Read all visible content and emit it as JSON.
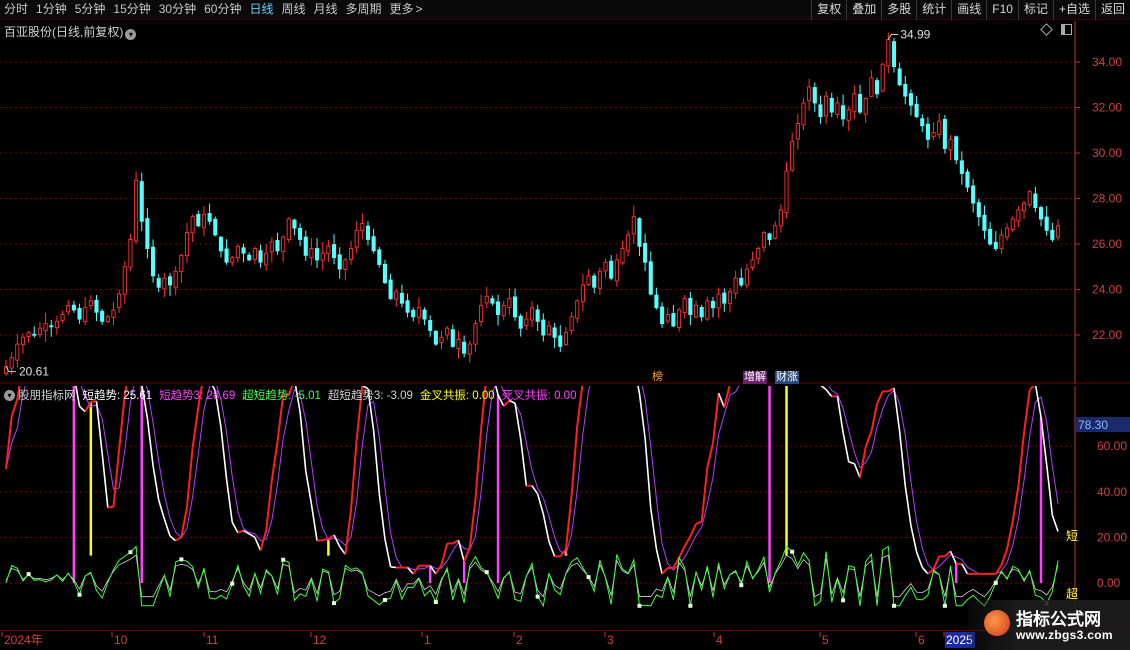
{
  "toolbar": {
    "periods": [
      "分时",
      "1分钟",
      "5分钟",
      "15分钟",
      "30分钟",
      "60分钟",
      "日线",
      "周线",
      "月线",
      "多周期",
      "更多"
    ],
    "active_period": "日线",
    "more_glyph": ">",
    "buttons": [
      "复权",
      "叠加",
      "多股",
      "统计",
      "画线",
      "F10",
      "标记",
      "+自选",
      "返回"
    ]
  },
  "price_panel": {
    "title": "百亚股份(日线,前复权)",
    "dropdown_icon": "chevron-down-icon",
    "right_icons": [
      "diamond-icon",
      "window-icon"
    ],
    "y_ticks": [
      "34.00",
      "32.00",
      "30.00",
      "28.00",
      "26.00",
      "24.00",
      "22.00"
    ],
    "high_label": "34.99",
    "low_label": "20.61",
    "badges": [
      {
        "text": "榜",
        "color": "#ffa040"
      },
      {
        "text": "增解",
        "color": "#ffffff",
        "bg": "#6a1f6a"
      },
      {
        "text": "财涨",
        "color": "#ffffff",
        "bg": "#2a4a7a"
      }
    ]
  },
  "indicator_panel": {
    "name": "股朋指标网",
    "legend": [
      {
        "label": "短趋势:",
        "value": "25.61",
        "color": "#ffffff"
      },
      {
        "label": "短趋势3:",
        "value": "28.69",
        "color": "#ff40ff"
      },
      {
        "label": "超短趋势:",
        "value": "-5.01",
        "color": "#40ff40"
      },
      {
        "label": "超短趋势3:",
        "value": "-3.09",
        "color": "#d0d0d0"
      },
      {
        "label": "金叉共振:",
        "value": "0.00",
        "color": "#ffff00"
      },
      {
        "label": "死叉共振:",
        "value": "0.00",
        "color": "#ff40ff"
      }
    ],
    "y_ticks": [
      "60.00",
      "40.00",
      "20.00",
      "0.00"
    ],
    "current_value": "78.30",
    "side_labels": [
      "短",
      "超"
    ]
  },
  "timeline": {
    "labels": [
      "2024年",
      "10",
      "11",
      "12",
      "1",
      "2",
      "3",
      "4",
      "5",
      "6",
      "2025"
    ]
  },
  "watermark": {
    "title": "指标公式网",
    "url": "www.zbgs3.com"
  },
  "colors": {
    "up": "#ff3232",
    "down": "#54ffff",
    "grid": "#7a0000",
    "axis": "#c03030"
  },
  "chart_data": {
    "type": "candlestick",
    "y_range": [
      20.5,
      35.3
    ],
    "highest": 34.99,
    "lowest": 20.61,
    "closes": [
      20.61,
      21.0,
      21.6,
      21.9,
      22.1,
      22.0,
      22.3,
      22.5,
      22.4,
      22.6,
      22.9,
      23.3,
      23.1,
      22.7,
      23.2,
      23.5,
      23.0,
      22.6,
      22.8,
      23.1,
      23.8,
      25.0,
      26.2,
      28.8,
      27.0,
      25.8,
      24.6,
      24.1,
      24.5,
      24.2,
      24.8,
      25.5,
      26.5,
      27.2,
      26.8,
      27.3,
      27.0,
      26.4,
      25.7,
      25.2,
      25.4,
      25.9,
      25.6,
      25.3,
      25.8,
      25.2,
      25.6,
      26.1,
      25.7,
      26.3,
      27.1,
      26.7,
      26.2,
      25.5,
      25.8,
      25.3,
      25.6,
      25.9,
      25.4,
      24.9,
      25.3,
      25.8,
      26.6,
      26.9,
      26.2,
      25.7,
      25.1,
      24.3,
      23.6,
      23.9,
      23.4,
      23.0,
      22.8,
      23.2,
      22.7,
      22.2,
      21.6,
      21.9,
      22.3,
      21.5,
      21.8,
      21.2,
      21.6,
      22.5,
      23.3,
      23.7,
      23.4,
      22.9,
      23.3,
      23.6,
      22.8,
      22.3,
      22.7,
      23.2,
      22.6,
      22.0,
      22.4,
      21.9,
      21.5,
      22.1,
      22.8,
      23.5,
      24.2,
      24.6,
      24.1,
      24.8,
      25.2,
      24.5,
      25.3,
      25.8,
      26.4,
      27.2,
      25.9,
      25.2,
      23.8,
      23.2,
      22.5,
      22.9,
      22.4,
      23.1,
      23.6,
      22.9,
      23.3,
      22.8,
      23.5,
      23.2,
      23.8,
      23.4,
      23.9,
      24.5,
      24.2,
      24.9,
      25.3,
      25.8,
      26.5,
      26.2,
      26.8,
      27.5,
      29.2,
      30.5,
      31.3,
      32.2,
      32.9,
      32.2,
      31.6,
      32.5,
      31.8,
      32.2,
      31.5,
      31.9,
      32.6,
      31.8,
      32.4,
      33.3,
      32.6,
      33.9,
      34.99,
      33.8,
      33.0,
      32.5,
      32.1,
      31.6,
      31.2,
      30.6,
      30.9,
      31.4,
      30.2,
      30.6,
      29.7,
      29.1,
      28.5,
      27.8,
      27.2,
      26.6,
      26.0,
      25.8,
      26.4,
      26.7,
      27.1,
      27.5,
      27.8,
      28.3,
      27.6,
      27.1,
      26.6,
      26.2,
      26.8
    ]
  }
}
